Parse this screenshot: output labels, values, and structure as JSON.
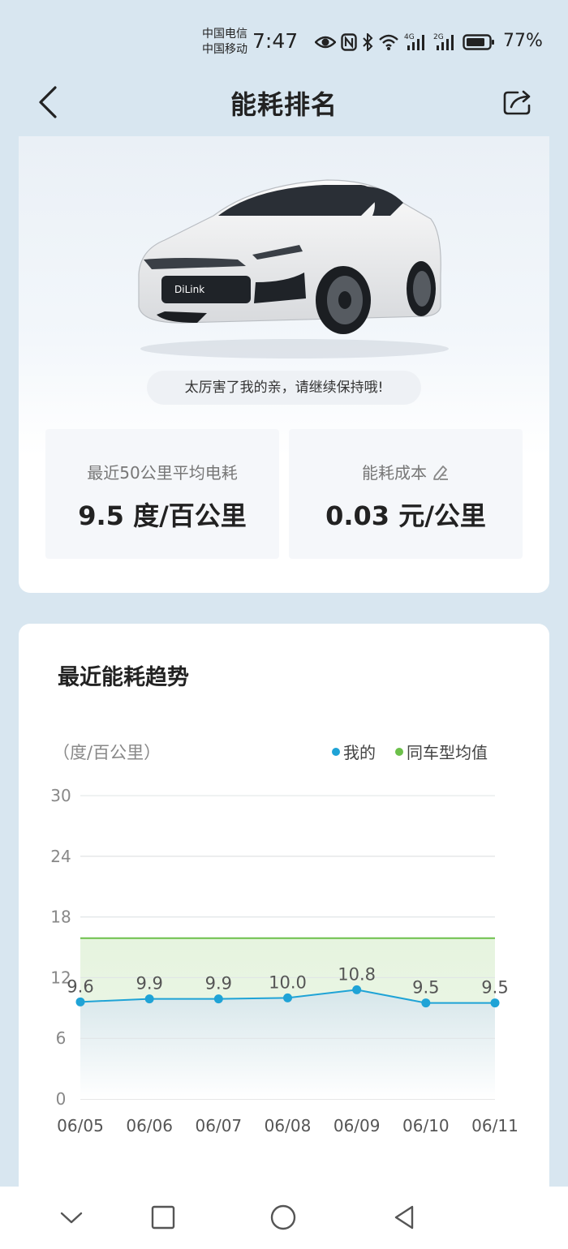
{
  "status_bar": {
    "carrier_1": "中国电信",
    "carrier_2": "中国移动",
    "time": "7:47",
    "battery": "77%",
    "icons": [
      "eye-icon",
      "nfc-icon",
      "bluetooth-icon",
      "wifi-icon",
      "signal-4g-icon",
      "signal-2g-icon",
      "battery-icon"
    ]
  },
  "header": {
    "title": "能耗排名",
    "back_icon": "chevron-left-icon",
    "share_icon": "share-icon"
  },
  "summary": {
    "encourage": "太厉害了我的亲，请继续保持哦!",
    "avg_label": "最近50公里平均电耗",
    "avg_value": "9.5 度/百公里",
    "cost_label": "能耗成本",
    "cost_value": "0.03 元/公里"
  },
  "trend": {
    "title": "最近能耗趋势"
  },
  "colors": {
    "mine": "#1fa3d6",
    "average": "#6cc04a"
  },
  "chart_data": {
    "type": "line",
    "unit_label": "（度/百公里）",
    "categories": [
      "06/05",
      "06/06",
      "06/07",
      "06/08",
      "06/09",
      "06/10",
      "06/11"
    ],
    "series": [
      {
        "name": "我的",
        "values": [
          9.6,
          9.9,
          9.9,
          10.0,
          10.8,
          9.5,
          9.5
        ],
        "labels": [
          "9.6",
          "9.9",
          "9.9",
          "10.0",
          "10.8",
          "9.5",
          "9.5"
        ]
      },
      {
        "name": "同车型均值",
        "values": [
          15.9,
          15.9,
          15.9,
          15.9,
          15.9,
          15.9,
          15.9
        ]
      }
    ],
    "yticks": [
      "0",
      "6",
      "12",
      "18",
      "24",
      "30"
    ],
    "ylim": [
      0,
      30
    ],
    "grid": true,
    "legend_position": "top-right"
  },
  "nav_bar": {
    "icons": [
      "chevron-down-icon",
      "square-icon",
      "circle-icon",
      "triangle-back-icon"
    ]
  }
}
